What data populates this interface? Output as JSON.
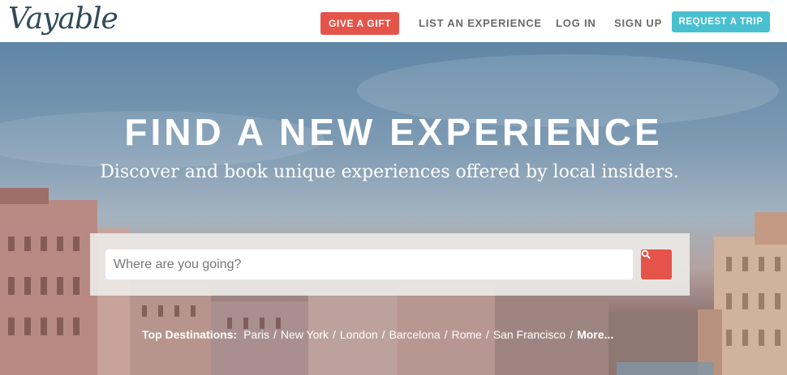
{
  "brand": {
    "logo_text": "Vayable"
  },
  "nav": {
    "gift_label": "GIVE A GIFT",
    "list_label": "LIST AN EXPERIENCE",
    "login_label": "LOG IN",
    "signup_label": "SIGN UP",
    "request_label": "REQUEST A TRIP"
  },
  "hero": {
    "title": "FIND A NEW EXPERIENCE",
    "subtitle": "Discover and book unique experiences offered by local insiders."
  },
  "search": {
    "placeholder": "Where are you going?",
    "button_icon": "search-icon"
  },
  "destinations": {
    "label": "Top Destinations:",
    "items": [
      "Paris",
      "New York",
      "London",
      "Barcelona",
      "Rome",
      "San Francisco"
    ],
    "separator": "/",
    "more_label": "More..."
  },
  "colors": {
    "gift": "#e4544a",
    "request": "#49c0d0",
    "logo": "#2f4a58",
    "search_button": "#e4544a"
  }
}
